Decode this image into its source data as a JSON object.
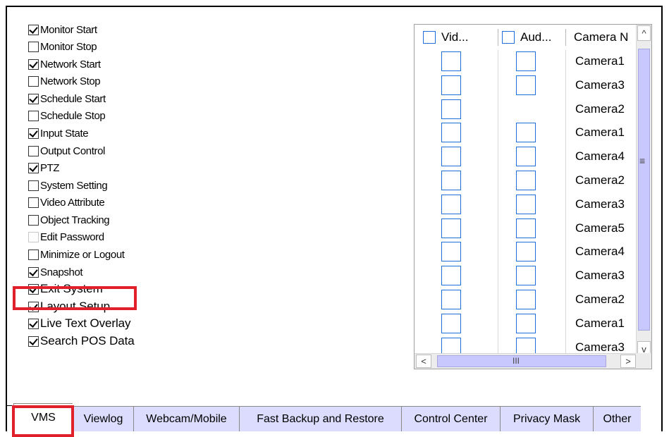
{
  "checkboxes": [
    {
      "label": "Monitor Start",
      "checked": true
    },
    {
      "label": "Monitor Stop",
      "checked": false
    },
    {
      "label": "Network Start",
      "checked": true
    },
    {
      "label": "Network Stop",
      "checked": false
    },
    {
      "label": "Schedule Start",
      "checked": true
    },
    {
      "label": "Schedule Stop",
      "checked": false
    },
    {
      "label": "Input State",
      "checked": true
    },
    {
      "label": "Output Control",
      "checked": false
    },
    {
      "label": "PTZ",
      "checked": true
    },
    {
      "label": "System Setting",
      "checked": false
    },
    {
      "label": "Video Attribute",
      "checked": false
    },
    {
      "label": "Object Tracking",
      "checked": false
    },
    {
      "label": "Edit Password",
      "checked": false,
      "disabled": true
    },
    {
      "label": "Minimize or Logout",
      "checked": false
    },
    {
      "label": "Snapshot",
      "checked": true
    },
    {
      "label": "Exit System",
      "checked": true
    },
    {
      "label": "Layout Setup",
      "checked": true
    },
    {
      "label": "Live Text Overlay",
      "checked": true
    },
    {
      "label": "Search POS Data",
      "checked": true
    }
  ],
  "grid": {
    "headers": [
      "Vid...",
      "Aud...",
      "Camera N"
    ],
    "rows": [
      {
        "camera": "Camera1",
        "audio_box": true
      },
      {
        "camera": "Camera3",
        "audio_box": true
      },
      {
        "camera": "Camera2",
        "audio_box": false
      },
      {
        "camera": "Camera1",
        "audio_box": true
      },
      {
        "camera": "Camera4",
        "audio_box": true
      },
      {
        "camera": "Camera2",
        "audio_box": true
      },
      {
        "camera": "Camera3",
        "audio_box": true
      },
      {
        "camera": "Camera5",
        "audio_box": true
      },
      {
        "camera": "Camera4",
        "audio_box": true
      },
      {
        "camera": "Camera3",
        "audio_box": true
      },
      {
        "camera": "Camera2",
        "audio_box": true
      },
      {
        "camera": "Camera1",
        "audio_box": true
      },
      {
        "camera": "Camera3",
        "audio_box": true
      }
    ],
    "scroll_up": "^",
    "scroll_down": "v",
    "scroll_left": "<",
    "scroll_right": ">",
    "v_grip": "≡",
    "h_grip": "III"
  },
  "tabs": [
    {
      "label": "VMS",
      "active": true
    },
    {
      "label": "Viewlog",
      "active": false
    },
    {
      "label": "Webcam/Mobile",
      "active": false
    },
    {
      "label": "Fast Backup and Restore",
      "active": false
    },
    {
      "label": "Control Center",
      "active": false
    },
    {
      "label": "Privacy Mask",
      "active": false
    },
    {
      "label": "Other",
      "active": false
    }
  ],
  "colors": {
    "highlight": "#e0202a",
    "tab_inactive": "#dcdcff",
    "scroll_thumb": "#c8c8ff",
    "checkbox_border_blue": "#1e6fd9"
  }
}
